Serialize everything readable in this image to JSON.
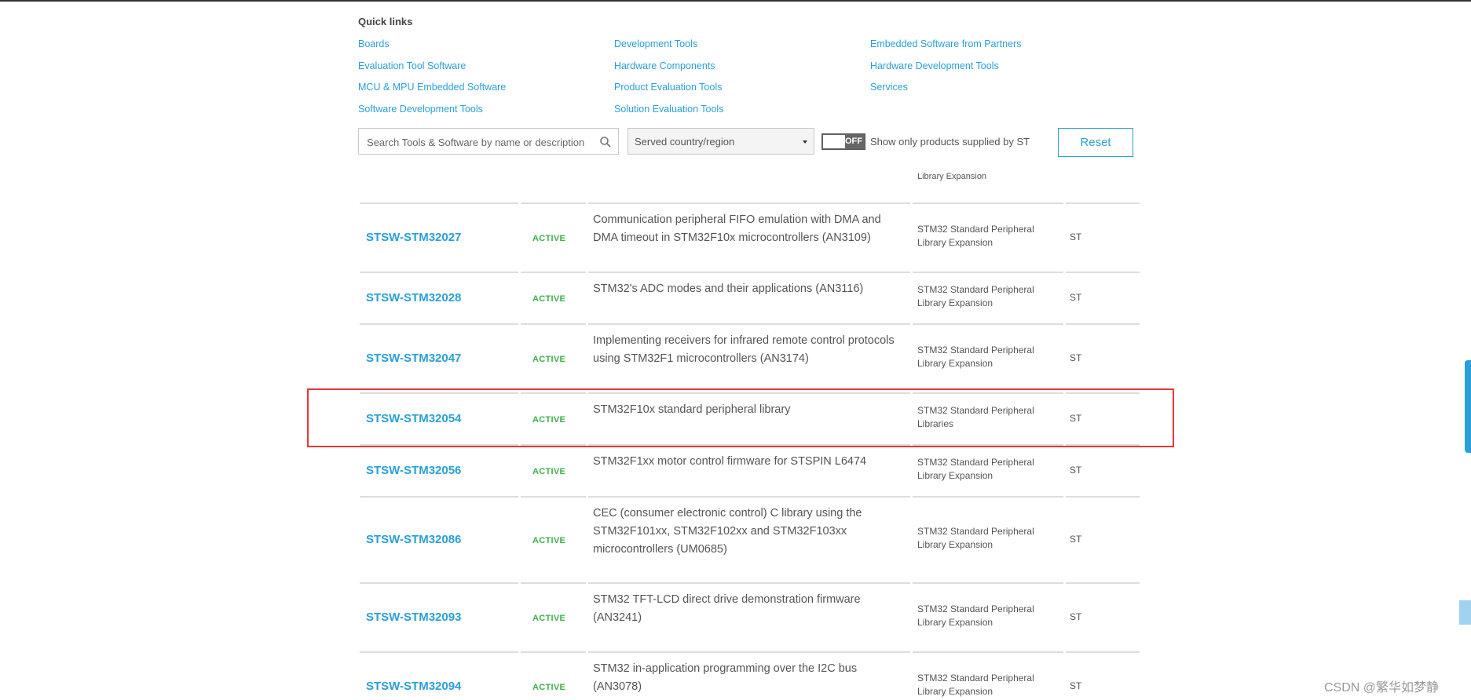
{
  "quick_links": {
    "title": "Quick links",
    "col1": [
      "Boards",
      "Evaluation Tool Software",
      "MCU & MPU Embedded Software",
      "Software Development Tools"
    ],
    "col2": [
      "Development Tools",
      "Hardware Components",
      "Product Evaluation Tools",
      "Solution Evaluation Tools"
    ],
    "col3": [
      "Embedded Software from Partners",
      "Hardware Development Tools",
      "Services"
    ]
  },
  "filters": {
    "search_placeholder": "Search Tools & Software by name or description",
    "country_value": "Served country/region",
    "toggle_state": "OFF",
    "toggle_label": "Show only products supplied by ST",
    "reset_label": "Reset"
  },
  "table": {
    "partial_top_text": "Library Expansion",
    "rows": [
      {
        "id": "STSW-STM32027",
        "status": "ACTIVE",
        "description": "Communication peripheral FIFO emulation with DMA and DMA timeout in STM32F10x microcontrollers (AN3109)",
        "type": "STM32 Standard Peripheral Library Expansion",
        "supplier": "ST"
      },
      {
        "id": "STSW-STM32028",
        "status": "ACTIVE",
        "description": "STM32's ADC modes and their applications (AN3116)",
        "type": "STM32 Standard Peripheral Library Expansion",
        "supplier": "ST"
      },
      {
        "id": "STSW-STM32047",
        "status": "ACTIVE",
        "description": "Implementing receivers for infrared remote control protocols using STM32F1 microcontrollers (AN3174)",
        "type": "STM32 Standard Peripheral Library Expansion",
        "supplier": "ST"
      },
      {
        "id": "STSW-STM32054",
        "status": "ACTIVE",
        "description": "STM32F10x standard peripheral library",
        "type": "STM32 Standard Peripheral Libraries",
        "supplier": "ST"
      },
      {
        "id": "STSW-STM32056",
        "status": "ACTIVE",
        "description": "STM32F1xx motor control firmware for STSPIN L6474",
        "type": "STM32 Standard Peripheral Library Expansion",
        "supplier": "ST"
      },
      {
        "id": "STSW-STM32086",
        "status": "ACTIVE",
        "description": "CEC (consumer electronic control) C library using the STM32F101xx, STM32F102xx and STM32F103xx microcontrollers (UM0685)",
        "type": "STM32 Standard Peripheral Library Expansion",
        "supplier": "ST"
      },
      {
        "id": "STSW-STM32093",
        "status": "ACTIVE",
        "description": "STM32 TFT-LCD direct drive demonstration firmware (AN3241)",
        "type": "STM32 Standard Peripheral Library Expansion",
        "supplier": "ST"
      },
      {
        "id": "STSW-STM32094",
        "status": "ACTIVE",
        "description": "STM32 in-application programming over the I2C bus (AN3078)",
        "type": "STM32 Standard Peripheral Library Expansion",
        "supplier": "ST"
      }
    ]
  },
  "watermark": "CSDN @繁华如梦静",
  "colors": {
    "link": "#2a9fd8",
    "active": "#3fae49",
    "highlight": "#e53935"
  }
}
